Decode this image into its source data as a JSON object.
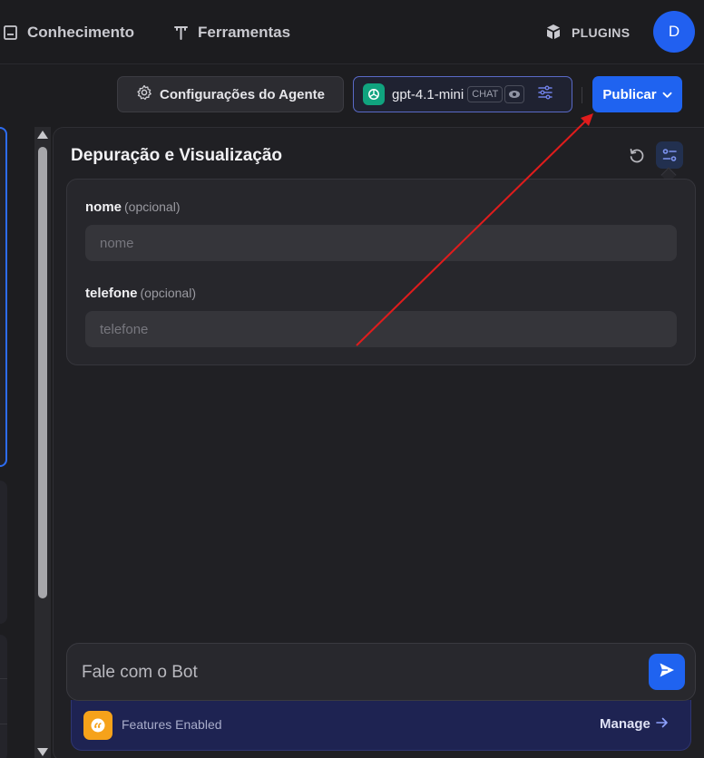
{
  "nav": {
    "knowledge_label": "Conhecimento",
    "tools_label": "Ferramentas",
    "plugins_label": "PLUGINS",
    "avatar_initial": "D",
    "icons": {
      "knowledge": "book-icon",
      "tools": "tool-icon",
      "plugins": "cube-icon"
    }
  },
  "toolbar": {
    "config_label": "Configurações do Agente",
    "model_name": "gpt-4.1-mini",
    "model_badge": "CHAT",
    "publish_label": "Publicar",
    "icons": {
      "config": "gear-icon",
      "model": "openai-logo-icon",
      "view": "eye-icon",
      "tune": "sliders-icon",
      "publish": "chevron-down-icon"
    }
  },
  "debug": {
    "title": "Depuração e Visualização",
    "icons": {
      "reset": "refresh-icon",
      "variables": "variables-icon"
    },
    "fields": [
      {
        "label": "nome",
        "optional": "(opcional)",
        "placeholder": "nome"
      },
      {
        "label": "telefone",
        "optional": "(opcional)",
        "placeholder": "telefone"
      }
    ]
  },
  "chat": {
    "placeholder": "Fale com o Bot",
    "features_text": "Features Enabled",
    "manage_label": "Manage",
    "icons": {
      "send": "send-icon",
      "features": "quote-icon",
      "manage": "arrow-right-icon"
    }
  },
  "colors": {
    "accent": "#1f63f0",
    "annotation": "#e01c1c",
    "features_bg": "#1e2352",
    "features_icon": "#f6a21a",
    "model_logo": "#10a37f"
  }
}
